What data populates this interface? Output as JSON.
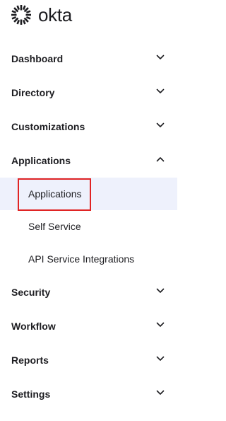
{
  "brand": {
    "name": "okta",
    "logo_icon": "okta-sunburst-icon"
  },
  "nav": {
    "sections": [
      {
        "label": "Dashboard",
        "state": "collapsed",
        "chevron": "chevron-down-icon"
      },
      {
        "label": "Directory",
        "state": "collapsed",
        "chevron": "chevron-down-icon"
      },
      {
        "label": "Customizations",
        "state": "collapsed",
        "chevron": "chevron-down-icon"
      },
      {
        "label": "Applications",
        "state": "expanded",
        "chevron": "chevron-up-icon",
        "items": [
          {
            "label": "Applications",
            "active": true
          },
          {
            "label": "Self Service",
            "active": false
          },
          {
            "label": "API Service Integrations",
            "active": false
          }
        ]
      },
      {
        "label": "Security",
        "state": "collapsed",
        "chevron": "chevron-down-icon"
      },
      {
        "label": "Workflow",
        "state": "collapsed",
        "chevron": "chevron-down-icon"
      },
      {
        "label": "Reports",
        "state": "collapsed",
        "chevron": "chevron-down-icon"
      },
      {
        "label": "Settings",
        "state": "collapsed",
        "chevron": "chevron-down-icon"
      }
    ]
  },
  "colors": {
    "text": "#1d1d21",
    "active_bg": "#eef1fc",
    "highlight_border": "#e02424"
  }
}
